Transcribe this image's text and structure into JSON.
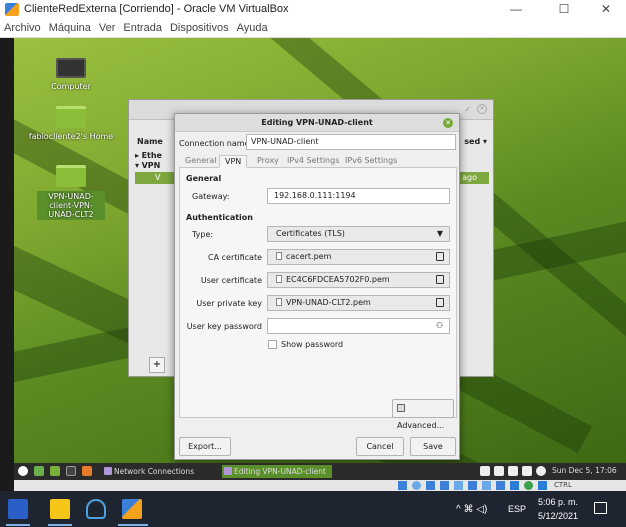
{
  "host_window": {
    "title": "ClienteRedExterna [Corriendo] - Oracle VM VirtualBox",
    "menu": [
      "Archivo",
      "Máquina",
      "Ver",
      "Entrada",
      "Dispositivos",
      "Ayuda"
    ]
  },
  "desktop": {
    "icons": [
      {
        "label": "Computer"
      },
      {
        "label": "fabiocliente2's Home"
      },
      {
        "label": "VPN-UNAD-client-VPN-UNAD-CLT2"
      }
    ]
  },
  "nc_window": {
    "col_name": "Name",
    "col_used": "sed ▾",
    "rows": [
      "Ethe",
      "VPN",
      "V"
    ],
    "sel_right": "ago",
    "add_button": "+"
  },
  "dialog": {
    "title": "Editing VPN-UNAD-client",
    "connection_name_label": "Connection name",
    "connection_name_value": "VPN-UNAD-client",
    "tabs": [
      "General",
      "VPN",
      "Proxy",
      "IPv4 Settings",
      "IPv6 Settings"
    ],
    "active_tab": "VPN",
    "general_heading": "General",
    "gateway_label": "Gateway:",
    "gateway_value": "192.168.0.111:1194",
    "auth_heading": "Authentication",
    "type_label": "Type:",
    "type_value": "Certificates (TLS)",
    "ca_label": "CA certificate",
    "ca_value": "cacert.pem",
    "user_cert_label": "User certificate",
    "user_cert_value": "EC4C6FDCEA5702F0.pem",
    "user_key_label": "User private key",
    "user_key_value": "VPN-UNAD-CLT2.pem",
    "key_pw_label": "User key password",
    "key_pw_value": "",
    "show_pw_label": "Show password",
    "advanced_label": "Advanced...",
    "export_label": "Export...",
    "cancel_label": "Cancel",
    "save_label": "Save"
  },
  "guest_panel": {
    "items": [
      "Network Connections",
      "Editing VPN-UNAD-client"
    ],
    "clock": "Sun Dec 5, 17:06"
  },
  "vbox_status": {
    "host_key": "CTRL"
  },
  "host_taskbar": {
    "lang": "ESP",
    "time": "5:06 p. m.",
    "date": "5/12/2021"
  },
  "colors": {
    "accent": "#7ea740",
    "mint_green": "#5a8f2a"
  }
}
